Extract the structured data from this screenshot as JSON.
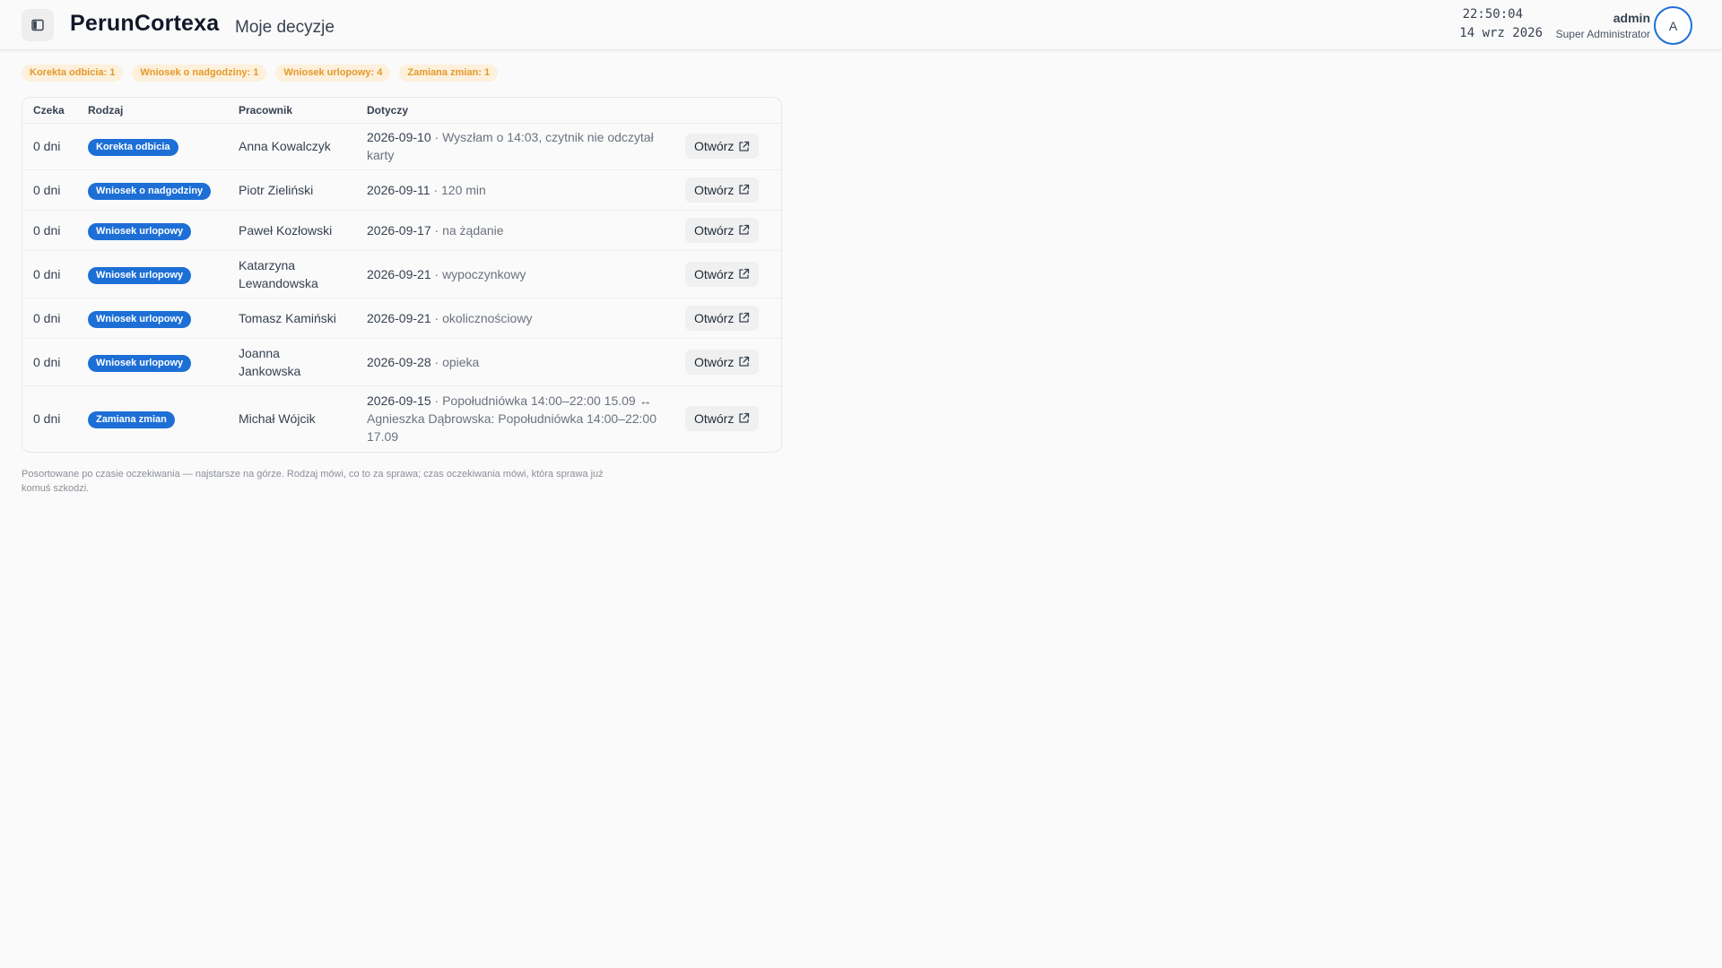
{
  "header": {
    "brand": "PerunCortexa",
    "page_title": "Moje decyzje",
    "time": "22:50:04",
    "date": "14 wrz 2026",
    "user_name": "admin",
    "user_role": "Super Administrator",
    "avatar_letter": "A",
    "sidebar_toggle_icon": "sidebar-panel-icon"
  },
  "chips": [
    "Korekta odbicia: 1",
    "Wniosek o nadgodziny: 1",
    "Wniosek urlopowy: 4",
    "Zamiana zmian: 1"
  ],
  "table": {
    "headers": {
      "wait": "Czeka",
      "type": "Rodzaj",
      "employee": "Pracownik",
      "concerns": "Dotyczy"
    },
    "action_label": "Otwórz",
    "action_icon": "external-link-icon",
    "rows": [
      {
        "wait": "0 dni",
        "type": "Korekta odbicia",
        "employee": "Anna Kowalczyk",
        "date": "2026-09-10",
        "detail": " · Wyszłam o 14:03, czytnik nie odczytał karty"
      },
      {
        "wait": "0 dni",
        "type": "Wniosek o nadgodziny",
        "employee": "Piotr Zieliński",
        "date": "2026-09-11",
        "detail": " · 120 min"
      },
      {
        "wait": "0 dni",
        "type": "Wniosek urlopowy",
        "employee": "Paweł Kozłowski",
        "date": "2026-09-17",
        "detail": " · na żądanie"
      },
      {
        "wait": "0 dni",
        "type": "Wniosek urlopowy",
        "employee": "Katarzyna Lewandowska",
        "date": "2026-09-21",
        "detail": " · wypoczynkowy"
      },
      {
        "wait": "0 dni",
        "type": "Wniosek urlopowy",
        "employee": "Tomasz Kamiński",
        "date": "2026-09-21",
        "detail": " · okolicznościowy"
      },
      {
        "wait": "0 dni",
        "type": "Wniosek urlopowy",
        "employee": "Joanna Jankowska",
        "date": "2026-09-28",
        "detail": " · opieka"
      },
      {
        "wait": "0 dni",
        "type": "Zamiana zmian",
        "employee": "Michał Wójcik",
        "date": "2026-09-15",
        "detail": " · Popołudniówka 14:00–22:00 15.09 ↔ Agnieszka Dąbrowska: Popołudniówka 14:00–22:00 17.09"
      }
    ]
  },
  "footnote": "Posortowane po czasie oczekiwania — najstarsze na górze. Rodzaj mówi, co to za sprawa; czas oczekiwania mówi, która sprawa już komuś szkodzi.",
  "colors": {
    "accent": "#1d6fd6",
    "chip_bg": "#fdf0dc",
    "chip_text": "#e39a2a"
  }
}
